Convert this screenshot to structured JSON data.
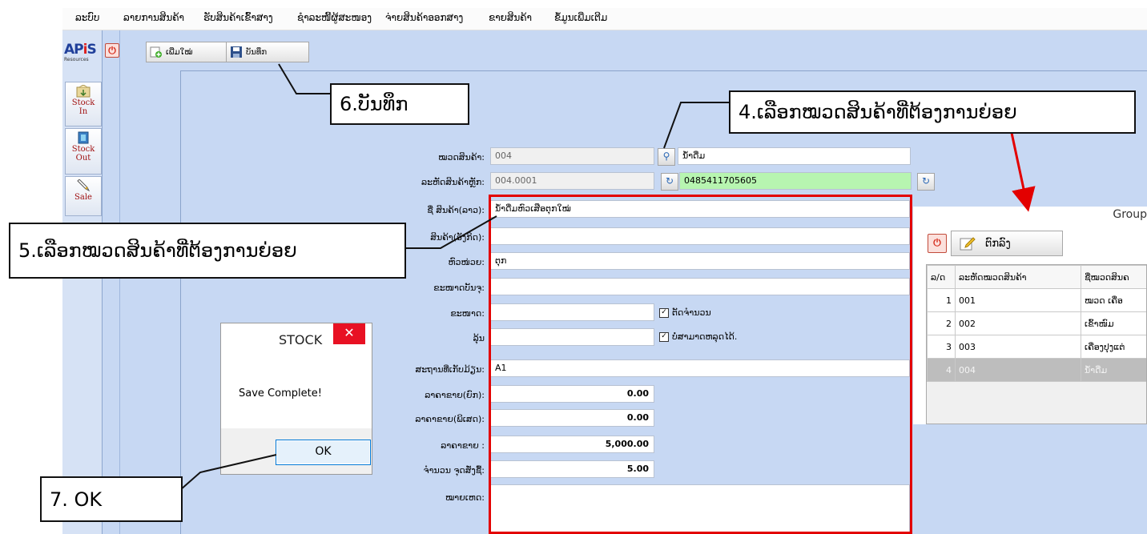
{
  "menu": [
    "ລະບົບ",
    "ລາຍການສິນຄ້າ",
    "ຮັບສິນຄ້າເຂົ້າສາງ",
    "ຊຳລະໜີ້ຜູ້ສະໜອງ",
    "ຈ່າຍສິນຄ້າອອກສາງ",
    "ຂາຍສິນຄ້າ",
    "ຂໍ້ມູນເພີ່ມເຕີມ"
  ],
  "logo": {
    "text_a": "AP",
    "text_i": "i",
    "text_s": "S",
    "sub": "Resources"
  },
  "rail": [
    {
      "line1": "Stock",
      "line2": "In"
    },
    {
      "line1": "Stock",
      "line2": "Out"
    },
    {
      "line1": "Sale",
      "line2": ""
    }
  ],
  "toolbar": {
    "add_label": "ເພີ່ມໃໝ່",
    "save_label": "ບັນທຶກ"
  },
  "form": {
    "category_label": "ໝວດສິນຄ້າ:",
    "category_code": "004",
    "category_name": "ນ້ຳດື່ມ",
    "sub_code_label": "ລະຫັດສິນຄ້າຫຼັກ:",
    "sub_code": "004.0001",
    "barcode": "0485411705605",
    "name_lao_label": "ຊື່ ສິນຄ້າ(ລາວ):",
    "name_lao": "ນ້ຳດື່ມຫົວເສືອຕຸກໃໝ່",
    "name_en_label": "ສິນຄ້າ(ອັງກິດ):",
    "name_en": "",
    "unit_label": "ຫົວໜ່ວຍ:",
    "unit": "ຕຸກ",
    "pack_size_label": "ຂະໜາດບັນຈຸ:",
    "pack_size": "",
    "size_label": "ຂະໜາດ:",
    "size": "",
    "color_label": "ລຸ້ນ",
    "color": "",
    "location_label": "ສະຖານທີ່ເກັບມ້ຽນ:",
    "location": "A1",
    "wholesale_label": "ລາຄາຂາຍ(ຍົກ):",
    "wholesale": "0.00",
    "special_label": "ລາຄາຂາຍ(ພິເສດ):",
    "special": "0.00",
    "price_label": "ລາຄາຂາຍ :",
    "price": "5,000.00",
    "reorder_label": "ຈຳນວນ ຈຸດສັ່ງຊື້:",
    "reorder": "5.00",
    "note_label": "ໝາຍເຫດ:",
    "note": "",
    "chk_stock_label": "ຕັດຈຳນວນ",
    "chk_discount_label": "ບໍ່ສາມາດຫລຸດໄດ້."
  },
  "dialog": {
    "title": "STOCK",
    "message": "Save Complete!",
    "ok_label": "OK",
    "close_glyph": "✕"
  },
  "group_panel": {
    "title": "Group",
    "edit_label": "ຕົກລົງ",
    "headers": [
      "ລ/ດ",
      "ລະຫັດໝວດສິນຄ້າ",
      "ຊື່ໝວດສິນຄ"
    ],
    "rows": [
      {
        "no": "1",
        "code": "001",
        "name": "ໝວດ ເຄື່ອ"
      },
      {
        "no": "2",
        "code": "002",
        "name": "ເຂົ້າໜົມ"
      },
      {
        "no": "3",
        "code": "003",
        "name": "ເຄື່ອງປຸງແຕ່"
      },
      {
        "no": "4",
        "code": "004",
        "name": "ນ້ຳດື່ມ"
      }
    ]
  },
  "callouts": {
    "c4": "4.ເລືອກໝວດສິນຄ້າທີ່ຕ້ອງການຍ່ອຍ",
    "c5": "5.ເລືອກໝວດສິນຄ້າທີ່ຕ້ອງການຍ່ອຍ",
    "c6": "6.ບັນທຶກ",
    "c7": "7.  OK"
  },
  "colors": {
    "app_bg": "#c7d8f3",
    "highlight": "#e30000",
    "barcode_bg": "#b7f5b0",
    "selected_row": "#bdbdbd"
  }
}
